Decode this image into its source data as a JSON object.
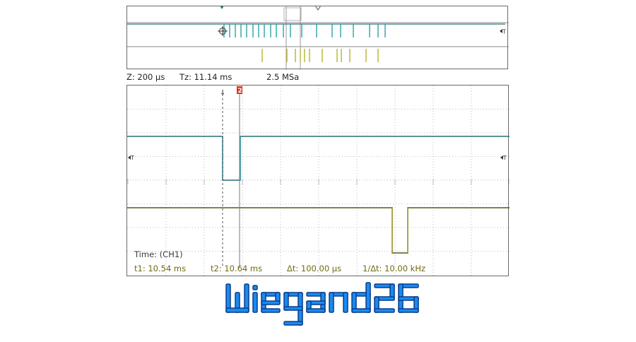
{
  "colors": {
    "ch1": "#2aa1a8",
    "ch1_dark": "#2b6e72",
    "ch2": "#b6b52c",
    "ch2_dark": "#555a12",
    "grid": "#a9a9a9",
    "marker2": "#d63a1e",
    "logo_fill": "#1a8bf0",
    "logo_edge": "#0a3c8a"
  },
  "overview": {
    "trigger_marker_label": "T"
  },
  "zoom_info": {
    "zoom": "Z: 200 µs",
    "trigger_zoom": "Tz: 11.14 ms",
    "sample_rate": "2.5 MSa"
  },
  "scope": {
    "trigger_label": "T",
    "cursor2_label": "2",
    "time_source": "Time: (CH1)",
    "t1": "t1: 10.54 ms",
    "t2": "t2: 10.64 ms",
    "delta_t": "Δt: 100.00 µs",
    "inv_delta_t": "1/Δt: 10.00 kHz"
  },
  "logo": {
    "text": "Wiegand26"
  }
}
